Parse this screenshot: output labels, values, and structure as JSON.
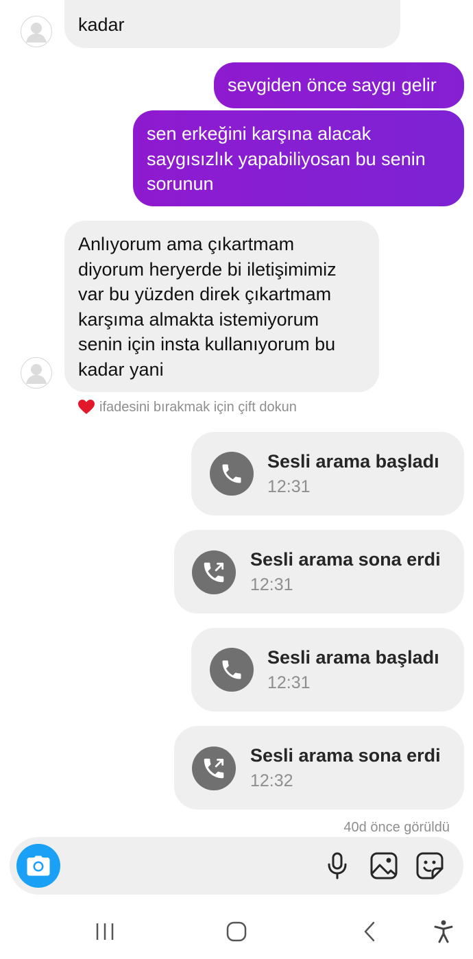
{
  "thread": {
    "messages": [
      {
        "direction": "received",
        "lines": [
          "kadar"
        ]
      },
      {
        "direction": "sent",
        "lines": [
          "sevgiden önce saygı gelir"
        ]
      },
      {
        "direction": "sent",
        "lines": [
          "sen erkeğini karşına alacak",
          "saygısızlık yapabiliyosan bu senin",
          "sorunun"
        ]
      },
      {
        "direction": "received",
        "lines": [
          "Anlıyorum ama çıkartmam",
          "diyorum heryerde bi iletişimimiz",
          "var bu yüzden direk çıkartmam",
          "karşıma almakta istemiyorum",
          "senin için insta kullanıyorum bu",
          "kadar yani"
        ]
      }
    ],
    "reaction_hint": "ifadesini bırakmak için çift dokun",
    "calls": [
      {
        "title": "Sesli arama başladı",
        "time": "12:31",
        "icon": "phone-icon"
      },
      {
        "title": "Sesli arama sona erdi",
        "time": "12:31",
        "icon": "phone-outgoing-icon"
      },
      {
        "title": "Sesli arama başladı",
        "time": "12:31",
        "icon": "phone-icon"
      },
      {
        "title": "Sesli arama sona erdi",
        "time": "12:32",
        "icon": "phone-outgoing-icon"
      }
    ],
    "seen_status": "40d önce görüldü"
  },
  "composer": {
    "buttons": [
      "camera-icon",
      "microphone-icon",
      "gallery-icon",
      "sticker-icon"
    ]
  },
  "system_nav": {
    "buttons": [
      "recent-apps-icon",
      "home-icon",
      "back-icon",
      "accessibility-icon"
    ]
  },
  "colors": {
    "sent_gradient_start": "#8f1ad0",
    "sent_gradient_end": "#7d23d4",
    "received_bubble": "#efefef",
    "call_icon_bg": "#707070",
    "camera_button": "#1aa1f5",
    "meta_text": "#8e8e8e",
    "heart": "#e2192b"
  }
}
